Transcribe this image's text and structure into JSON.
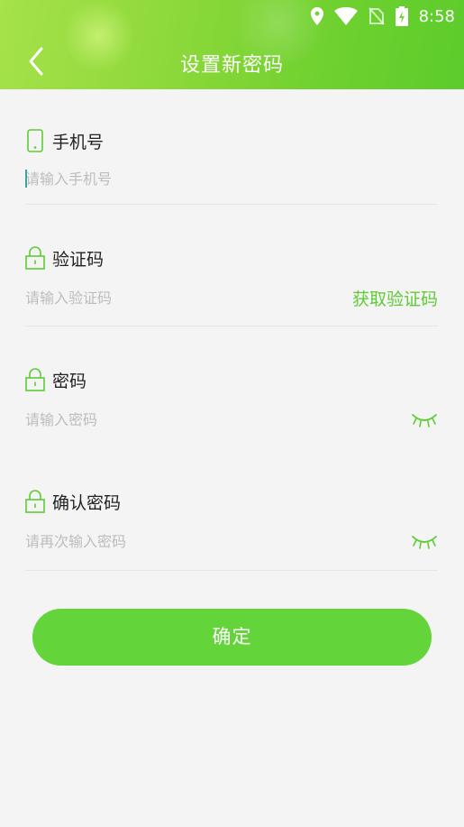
{
  "status_bar": {
    "time": "8:58",
    "icons": [
      "location-icon",
      "wifi-icon",
      "no-sim-icon",
      "battery-charging-icon"
    ]
  },
  "header": {
    "title": "设置新密码",
    "back_icon": "chevron-left-icon"
  },
  "fields": {
    "phone": {
      "label": "手机号",
      "placeholder": "请输入手机号",
      "icon": "phone-icon"
    },
    "code": {
      "label": "验证码",
      "placeholder": "请输入验证码",
      "icon": "lock-icon",
      "action": "获取验证码"
    },
    "password": {
      "label": "密码",
      "placeholder": "请输入密码",
      "icon": "lock-icon",
      "toggle_icon": "eye-closed-icon"
    },
    "confirm_password": {
      "label": "确认密码",
      "placeholder": "请再次输入密码",
      "icon": "lock-icon",
      "toggle_icon": "eye-closed-icon"
    }
  },
  "submit": {
    "label": "确定"
  },
  "colors": {
    "accent": "#63d43a",
    "header_start": "#a6e24a",
    "header_end": "#5ccc2c",
    "background": "#f4f4f4"
  }
}
